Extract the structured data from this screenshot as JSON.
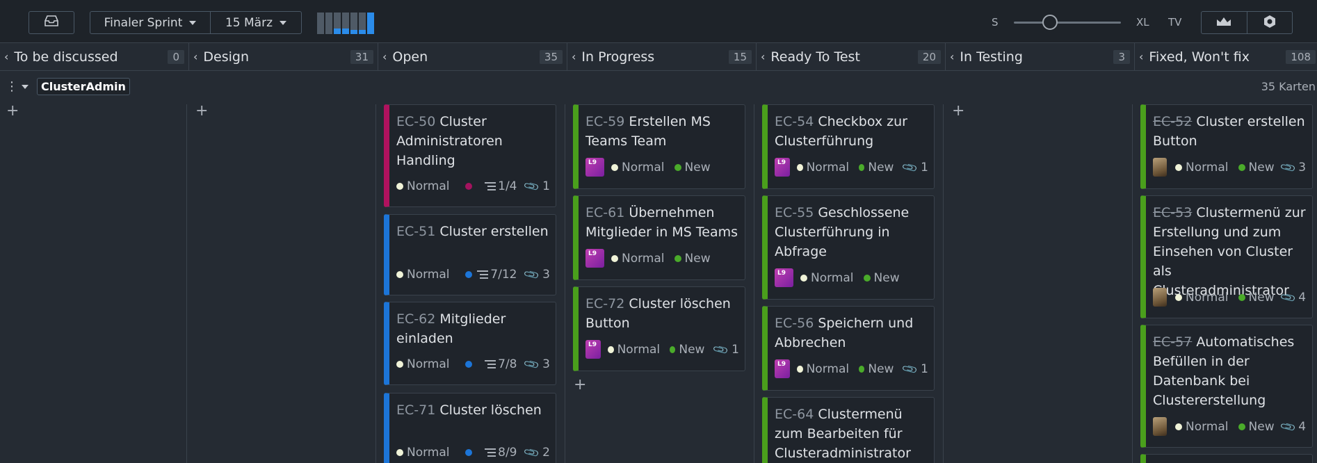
{
  "toolbar": {
    "inbox_icon": "inbox-tray-icon",
    "sprint": "Finaler Sprint",
    "date": "15 März",
    "burndown_bars": [
      0.0,
      0.0,
      0.25,
      0.25,
      0.18,
      0.18,
      1.0
    ],
    "zoom": {
      "small": "S",
      "large": "XL",
      "tv": "TV",
      "level": 0.27
    },
    "view_icons": [
      "crown-icon",
      "hexagon-icon"
    ]
  },
  "columns": [
    {
      "title": "To be discussed",
      "count": "0"
    },
    {
      "title": "Design",
      "count": "31"
    },
    {
      "title": "Open",
      "count": "35"
    },
    {
      "title": "In Progress",
      "count": "15"
    },
    {
      "title": "Ready To Test",
      "count": "20"
    },
    {
      "title": "In Testing",
      "count": "3"
    },
    {
      "title": "Fixed, Won't fix",
      "count": "108"
    }
  ],
  "swimlane": {
    "name": "ClusterAdmin",
    "count": "35 Karten"
  },
  "add_symbol": "+",
  "avatar_initials": "L9",
  "cards": {
    "open": [
      {
        "key": "EC-50",
        "title": "Cluster Administratoren Handling",
        "priority": "Normal",
        "subtasks": "1/4",
        "attachments": "1"
      },
      {
        "key": "EC-51",
        "title": "Cluster erstellen",
        "priority": "Normal",
        "subtasks": "7/12",
        "attachments": "3"
      },
      {
        "key": "EC-62",
        "title": "Mitglieder einladen",
        "priority": "Normal",
        "subtasks": "7/8",
        "attachments": "3"
      },
      {
        "key": "EC-71",
        "title": "Cluster löschen",
        "priority": "Normal",
        "subtasks": "8/9",
        "attachments": "2"
      }
    ],
    "in_progress": [
      {
        "key": "EC-59",
        "title": "Erstellen MS Teams Team",
        "priority": "Normal",
        "status": "New"
      },
      {
        "key": "EC-61",
        "title": "Übernehmen Mitglieder in MS Teams",
        "priority": "Normal",
        "status": "New"
      },
      {
        "key": "EC-72",
        "title": "Cluster löschen Button",
        "priority": "Normal",
        "status": "New",
        "attachments": "1"
      }
    ],
    "ready_to_test": [
      {
        "key": "EC-54",
        "title": "Checkbox zur Clusterführung",
        "priority": "Normal",
        "status": "New",
        "attachments": "1"
      },
      {
        "key": "EC-55",
        "title": "Geschlossene Clusterführung in Abfrage",
        "priority": "Normal",
        "status": "New"
      },
      {
        "key": "EC-56",
        "title": "Speichern und Abbrechen",
        "priority": "Normal",
        "status": "New",
        "attachments": "1"
      },
      {
        "key": "EC-64",
        "title": "Clustermenü zum Bearbeiten für Clusteradministrator",
        "priority": "Normal",
        "status": "New"
      }
    ],
    "fixed": [
      {
        "key": "EC-52",
        "title": "Cluster erstellen Button",
        "priority": "Normal",
        "status": "New",
        "attachments": "3"
      },
      {
        "key": "EC-53",
        "title": "Clustermenü zur Erstellung und zum Einsehen von Cluster als Clusteradministrator",
        "priority": "Normal",
        "status": "New",
        "attachments": "4"
      },
      {
        "key": "EC-57",
        "title": "Automatisches Befüllen in der Datenbank bei Clustererstellung",
        "priority": "Normal",
        "status": "New",
        "attachments": "4"
      }
    ]
  }
}
